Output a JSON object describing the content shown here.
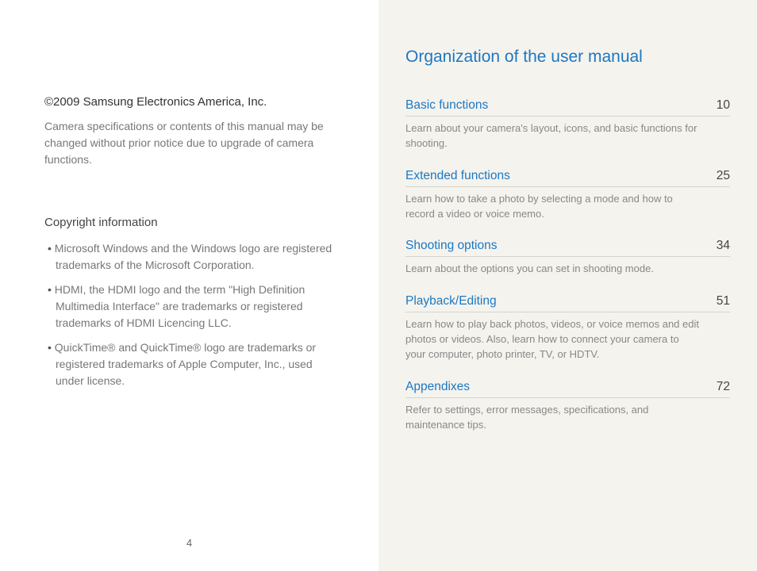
{
  "left": {
    "copyright": "©2009 Samsung Electronics America, Inc.",
    "notice": "Camera specifications or contents of this manual may be changed without prior notice due to upgrade of camera functions.",
    "sub_heading": "Copyright information",
    "bullets": [
      "Microsoft Windows and the Windows logo are registered trademarks of the Microsoft Corporation.",
      "HDMI, the HDMI logo and the term \"High Definition Multimedia Interface\" are trademarks or registered trademarks of HDMI Licencing LLC.",
      "QuickTime® and QuickTime® logo are trademarks or registered trademarks of Apple Computer, Inc., used under license."
    ],
    "page_number": "4"
  },
  "right": {
    "title": "Organization of the user manual",
    "entries": [
      {
        "name": "Basic functions",
        "page": "10",
        "desc": "Learn about your camera's layout, icons, and basic functions for shooting."
      },
      {
        "name": "Extended functions",
        "page": "25",
        "desc": "Learn how to take a photo by selecting a mode and how to record a video or voice memo."
      },
      {
        "name": "Shooting options",
        "page": "34",
        "desc": "Learn about the options you can set in shooting mode."
      },
      {
        "name": "Playback/Editing",
        "page": "51",
        "desc": "Learn how to play back photos, videos, or voice memos and edit photos or videos. Also, learn how to connect your camera to your computer, photo printer, TV, or HDTV."
      },
      {
        "name": "Appendixes",
        "page": "72",
        "desc": "Refer to settings, error messages, specifications, and maintenance tips."
      }
    ]
  }
}
